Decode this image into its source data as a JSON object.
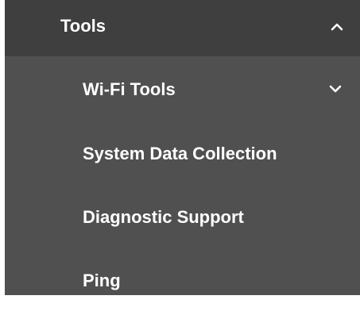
{
  "menu": {
    "header": {
      "label": "Tools",
      "expanded": true,
      "icon": "chevron-up-icon"
    },
    "items": [
      {
        "label": "Wi-Fi Tools",
        "has_submenu": true,
        "icon": "chevron-down-icon"
      },
      {
        "label": "System Data Collection"
      },
      {
        "label": "Diagnostic Support"
      },
      {
        "label": "Ping"
      }
    ]
  },
  "colors": {
    "header_bg": "#3f3f3f",
    "panel_bg": "#505050",
    "text": "#ffffff"
  }
}
